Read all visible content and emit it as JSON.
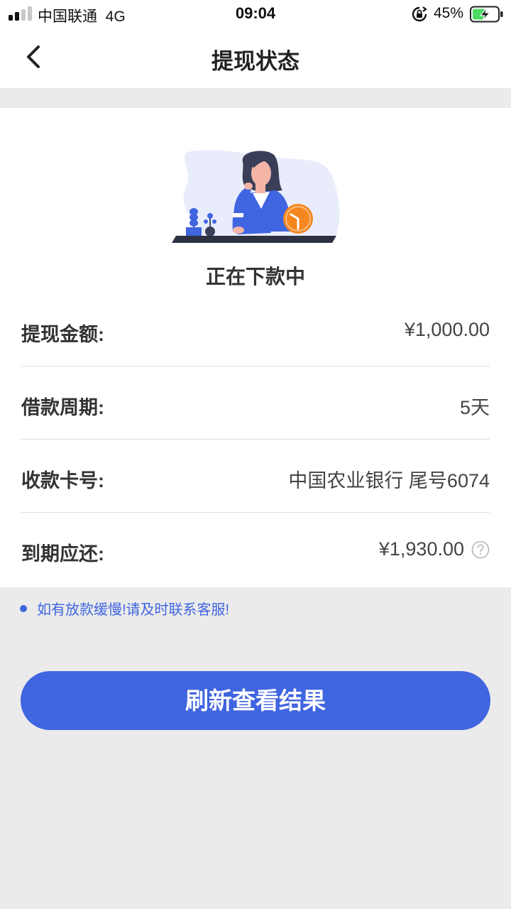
{
  "status_bar": {
    "carrier": "中国联通",
    "network": "4G",
    "time": "09:04",
    "battery_percent": "45%"
  },
  "nav": {
    "title": "提现状态"
  },
  "main": {
    "status_text": "正在下款中",
    "rows": [
      {
        "label": "提现金额:",
        "value": "¥1,000.00"
      },
      {
        "label": "借款周期:",
        "value": "5天"
      },
      {
        "label": "收款卡号:",
        "value": "中国农业银行 尾号6074"
      },
      {
        "label": "到期应还:",
        "value": "¥1,930.00"
      }
    ]
  },
  "notice": {
    "text": "如有放款缓慢!请及时联系客服!"
  },
  "button": {
    "label": "刷新查看结果"
  },
  "colors": {
    "accent": "#4065e0",
    "background": "#ebebeb",
    "clock": "#f5871f"
  },
  "icons": [
    "signal-icon",
    "rotation-lock-icon",
    "battery-charging-icon",
    "back-arrow-icon",
    "help-icon"
  ]
}
